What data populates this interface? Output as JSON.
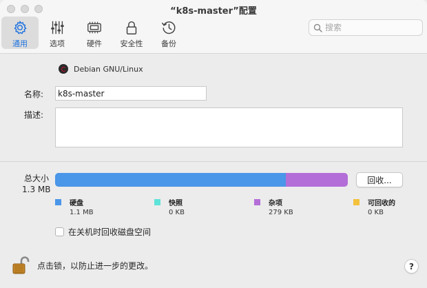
{
  "window": {
    "title": "“k8s-master”配置"
  },
  "toolbar": {
    "tabs": [
      {
        "label": "通用",
        "icon": "gear-icon",
        "selected": true
      },
      {
        "label": "选项",
        "icon": "sliders-icon",
        "selected": false
      },
      {
        "label": "硬件",
        "icon": "chip-icon",
        "selected": false
      },
      {
        "label": "安全性",
        "icon": "lock-icon",
        "selected": false
      },
      {
        "label": "备份",
        "icon": "history-clock-icon",
        "selected": false
      }
    ],
    "search_placeholder": "搜索"
  },
  "os": {
    "name": "Debian GNU/Linux",
    "icon": "debian-logo-icon"
  },
  "form": {
    "name_label": "名称:",
    "name_value": "k8s-master",
    "desc_label": "描述:",
    "desc_value": ""
  },
  "storage": {
    "total_label": "总大小",
    "total_value": "1.3 MB",
    "reclaim_button": "回收...",
    "segments": [
      {
        "name": "硬盘",
        "value": "1.1 MB",
        "color": "#4a96e8",
        "fraction": 0.788
      },
      {
        "name": "快照",
        "value": "0 KB",
        "color": "#5ee3d9",
        "fraction": 0.0
      },
      {
        "name": "杂项",
        "value": "279 KB",
        "color": "#b46ed8",
        "fraction": 0.212
      },
      {
        "name": "可回收的",
        "value": "0 KB",
        "color": "#f3c13c",
        "fraction": 0.0
      }
    ],
    "reclaim_on_shutdown_label": "在关机时回收磁盘空间",
    "reclaim_on_shutdown_checked": false
  },
  "footer": {
    "lock_text": "点击锁，以防止进一步的更改。",
    "help_label": "?"
  }
}
